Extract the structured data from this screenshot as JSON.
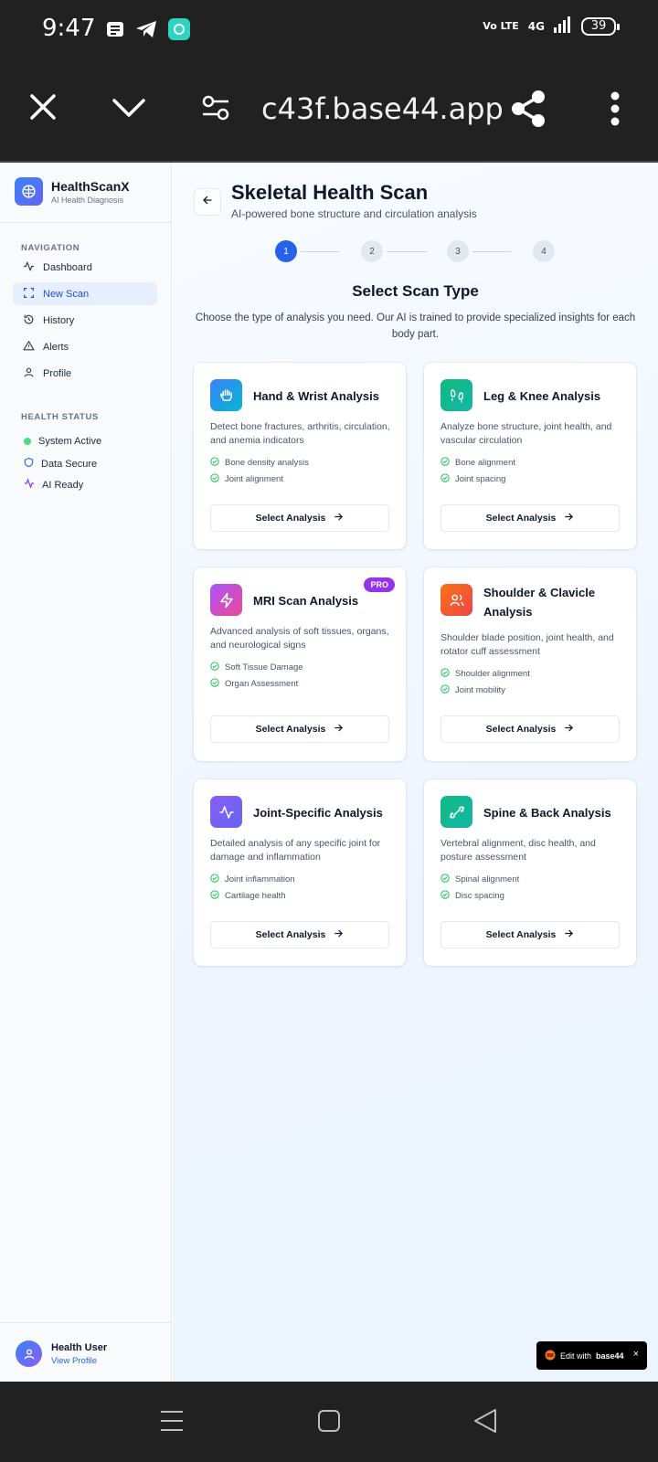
{
  "status_bar": {
    "time": "9:47",
    "network": "4G",
    "volte": "Vo LTE",
    "battery": "39"
  },
  "browser": {
    "url": "c43f.base44.app"
  },
  "sidebar": {
    "brand_name": "HealthScanX",
    "brand_sub": "AI Health Diagnosis",
    "nav_title": "NAVIGATION",
    "nav_items": [
      {
        "label": "Dashboard",
        "icon": "activity-icon"
      },
      {
        "label": "New Scan",
        "icon": "scan-icon",
        "active": true
      },
      {
        "label": "History",
        "icon": "history-icon"
      },
      {
        "label": "Alerts",
        "icon": "alert-triangle-icon"
      },
      {
        "label": "Profile",
        "icon": "user-icon"
      }
    ],
    "status_title": "HEALTH STATUS",
    "status_items": [
      {
        "label": "System Active",
        "icon": "green-dot-icon"
      },
      {
        "label": "Data Secure",
        "icon": "shield-icon"
      },
      {
        "label": "AI Ready",
        "icon": "activity-icon"
      }
    ],
    "user": {
      "name": "Health User",
      "link": "View Profile"
    }
  },
  "main": {
    "title": "Skeletal Health Scan",
    "subtitle": "AI-powered bone structure and circulation analysis",
    "steps": [
      "1",
      "2",
      "3",
      "4"
    ],
    "active_step": 1,
    "section_title": "Select Scan Type",
    "section_desc": "Choose the type of analysis you need. Our AI is trained to provide specialized insights for each body part.",
    "cards": [
      {
        "title": "Hand & Wrist Analysis",
        "icon": "hand-icon",
        "color": "#0ea5e9",
        "description": "Detect bone fractures, arthritis, circulation, and anemia indicators",
        "features": [
          "Bone density analysis",
          "Joint alignment"
        ],
        "button": "Select Analysis"
      },
      {
        "title": "Leg & Knee Analysis",
        "icon": "footprints-icon",
        "color": "#10b981",
        "description": "Analyze bone structure, joint health, and vascular circulation",
        "features": [
          "Bone alignment",
          "Joint spacing"
        ],
        "button": "Select Analysis"
      },
      {
        "title": "MRI Scan Analysis",
        "icon": "zap-icon",
        "color": "#c026d3",
        "badge": "PRO",
        "description": "Advanced analysis of soft tissues, organs, and neurological signs",
        "features": [
          "Soft Tissue Damage",
          "Organ Assessment"
        ],
        "button": "Select Analysis"
      },
      {
        "title": "Shoulder & Clavicle Analysis",
        "icon": "users-icon",
        "color": "#f97316",
        "description": "Shoulder blade position, joint health, and rotator cuff assessment",
        "features": [
          "Shoulder alignment",
          "Joint mobility"
        ],
        "button": "Select Analysis"
      },
      {
        "title": "Joint-Specific Analysis",
        "icon": "activity-icon",
        "color": "#8b5cf6",
        "description": "Detailed analysis of any specific joint for damage and inflammation",
        "features": [
          "Joint inflammation",
          "Cartilage health"
        ],
        "button": "Select Analysis"
      },
      {
        "title": "Spine & Back Analysis",
        "icon": "bone-icon",
        "color": "#10b981",
        "description": "Vertebral alignment, disc health, and posture assessment",
        "features": [
          "Spinal alignment",
          "Disc spacing"
        ],
        "button": "Select Analysis"
      }
    ]
  },
  "edit_badge": {
    "prefix": "Edit with",
    "brand": "base44",
    "close": "×"
  }
}
